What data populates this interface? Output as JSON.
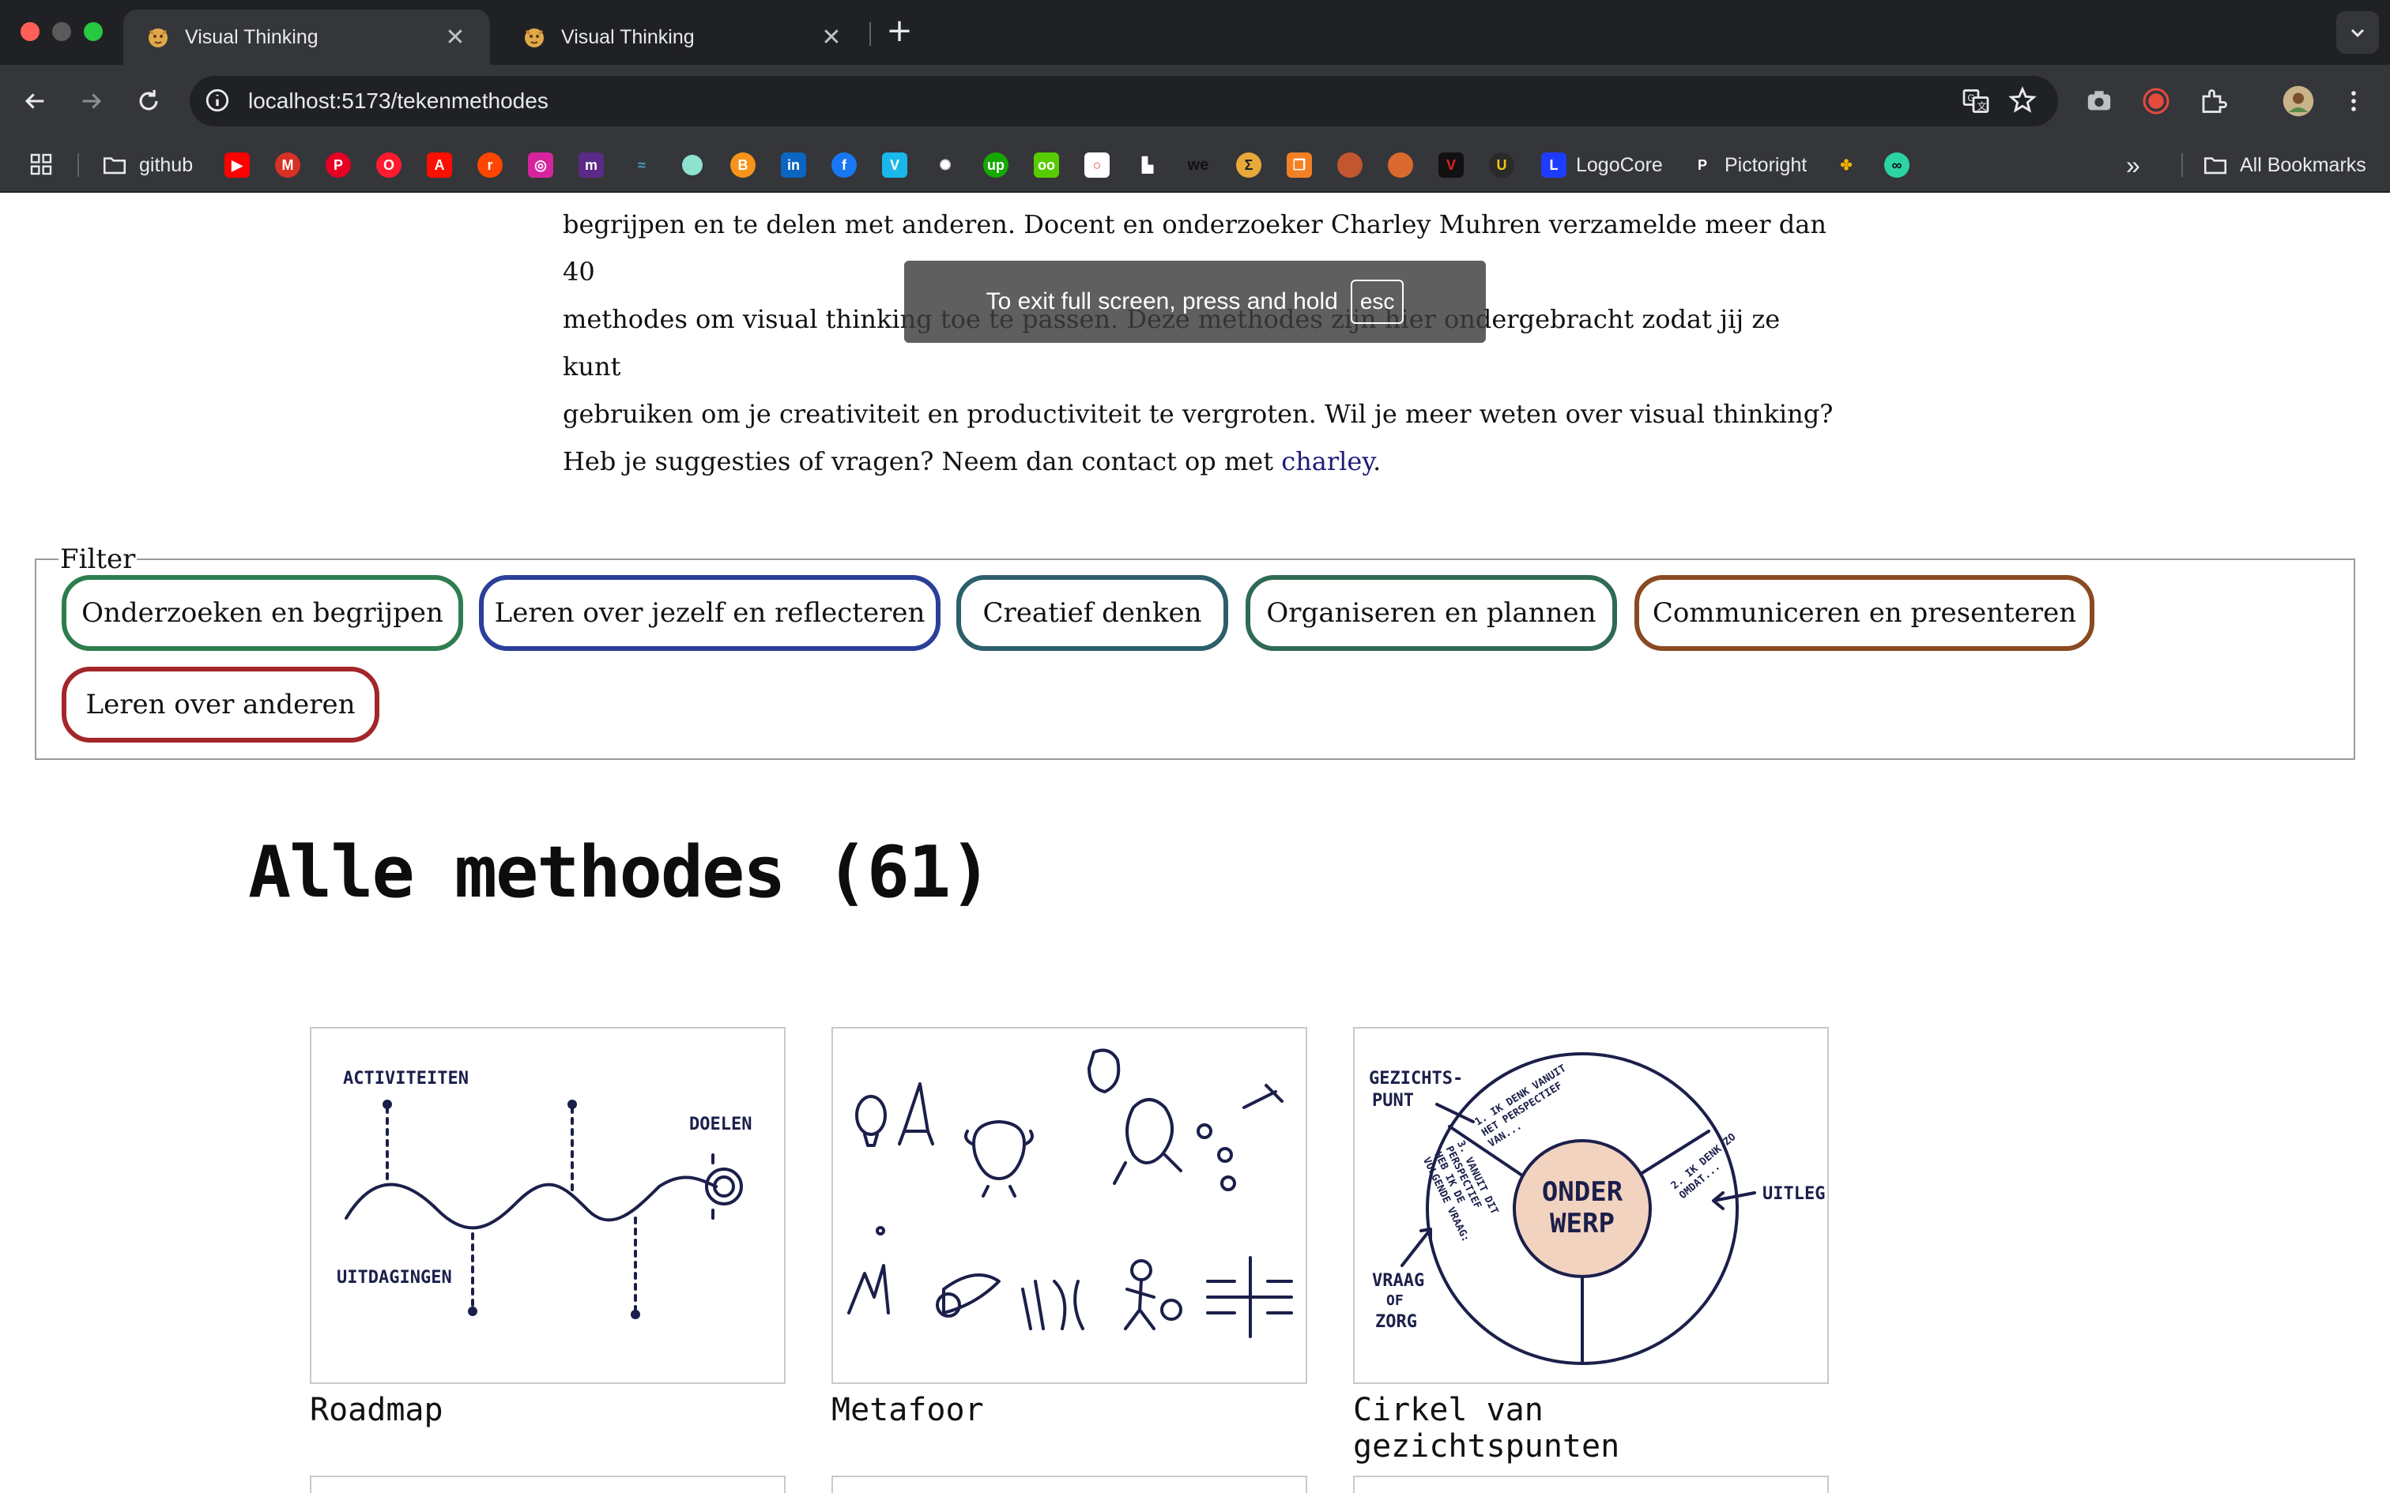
{
  "browser": {
    "tabs": [
      {
        "title": "Visual Thinking",
        "active": true
      },
      {
        "title": "Visual Thinking",
        "active": false
      }
    ],
    "url": "localhost:5173/tekenmethodes",
    "bookmarks": {
      "folder_github": "github",
      "logocore": "LogoCore",
      "pictoright": "Pictoright",
      "all_bookmarks": "All Bookmarks"
    }
  },
  "page": {
    "intro_lines": [
      "begrijpen en te delen met anderen. Docent en onderzoeker Charley Muhren verzamelde meer dan 40",
      "methodes om visual thinking toe te passen. Deze methodes zijn hier ondergebracht zodat jij ze kunt",
      "gebruiken om je creativiteit en productiviteit te vergroten. Wil je meer weten over visual thinking?"
    ],
    "intro_last_prefix": "Heb je suggesties of vragen? Neem dan contact op met ",
    "intro_link": "charley",
    "intro_last_suffix": ".",
    "toast": {
      "text": "To exit full screen, press and hold",
      "key": "esc"
    },
    "filter": {
      "legend": "Filter",
      "chips": [
        {
          "label": "Onderzoeken en begrijpen",
          "color": "#2e7d4f"
        },
        {
          "label": "Leren over jezelf en reflecteren",
          "color": "#2b3f9a"
        },
        {
          "label": "Creatief denken",
          "color": "#2d5e6b"
        },
        {
          "label": "Organiseren en plannen",
          "color": "#2f6b52"
        },
        {
          "label": "Communiceren en presenteren",
          "color": "#8a4a22"
        },
        {
          "label": "Leren over anderen",
          "color": "#a3262a"
        }
      ]
    },
    "heading": "Alle methodes (61)",
    "cards": [
      {
        "title": "Roadmap",
        "labels": {
          "top": "ACTIVITEITEN",
          "goal": "DOELEN",
          "bottom": "UITDAGINGEN"
        }
      },
      {
        "title": "Metafoor"
      },
      {
        "title": "Cirkel van gezichtspunten",
        "labels": {
          "center1": "ONDER",
          "center2": "WERP",
          "viewpoint1": "GEZICHTS-",
          "viewpoint2": "PUNT",
          "explain": "UITLEG",
          "q1": "VRAAG",
          "q2": "OF",
          "q3": "ZORG",
          "s1a": "1. IK DENK VANUIT",
          "s1b": "HET PERSPECTIEF",
          "s1c": "VAN...",
          "s2a": "2. IK DENK ZO",
          "s2b": "OMDAT...",
          "s3a": "3. VANUIT DIT",
          "s3b": "PERSPECTIEF",
          "s3c": "HEB IK DE",
          "s3d": "VOLGENDE VRAAG:"
        }
      }
    ]
  },
  "colors": {
    "tabbar": "#202124",
    "toolbar": "#35363a",
    "ink": "#1b1f4a",
    "center_fill": "#f2d3c0"
  }
}
